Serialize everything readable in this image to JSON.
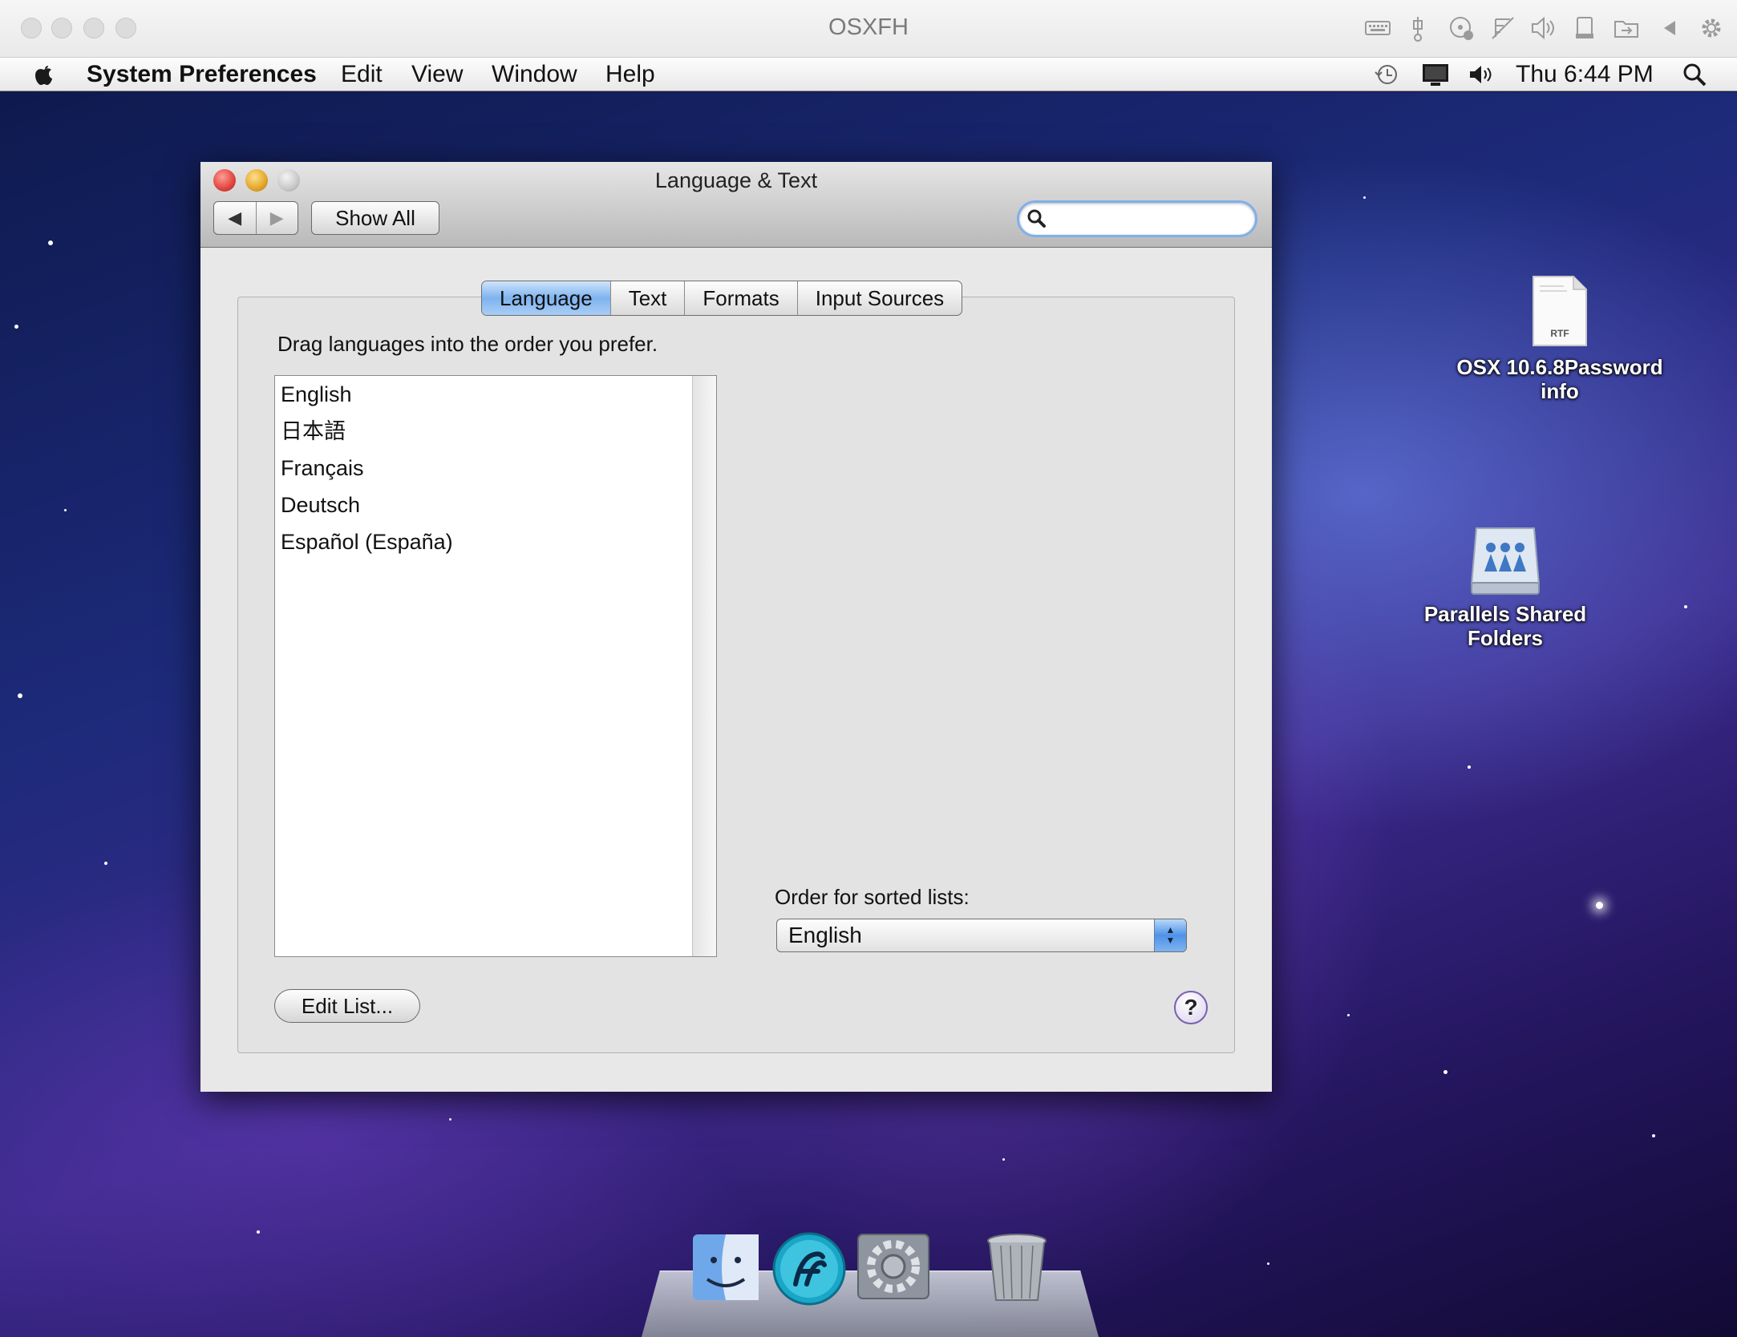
{
  "host": {
    "title": "OSXFH"
  },
  "menubar": {
    "app_name": "System Preferences",
    "items": [
      "Edit",
      "View",
      "Window",
      "Help"
    ],
    "clock": "Thu 6:44 PM"
  },
  "window": {
    "title": "Language & Text",
    "show_all_label": "Show All",
    "search_placeholder": "",
    "tabs": [
      "Language",
      "Text",
      "Formats",
      "Input Sources"
    ],
    "active_tab": "Language",
    "instruction": "Drag languages into the order you prefer.",
    "languages": [
      "English",
      "日本語",
      "Français",
      "Deutsch",
      "Español (España)"
    ],
    "sort_label": "Order for sorted lists:",
    "sort_value": "English",
    "edit_list_label": "Edit List...",
    "help_label": "?"
  },
  "desktop": {
    "icons": [
      {
        "label": "OSX 10.6.8Password info",
        "badge": "RTF",
        "icon": "rtf-document-icon"
      },
      {
        "label": "Parallels Shared Folders",
        "icon": "shared-folders-drive-icon"
      }
    ]
  },
  "dock": {
    "items": [
      {
        "icon": "finder-icon"
      },
      {
        "icon": "app-blue-swirl-icon"
      },
      {
        "icon": "system-preferences-icon"
      },
      {
        "icon": "trash-icon"
      }
    ]
  },
  "colors": {
    "accent_blue": "#7eb3ef",
    "close_red": "#e0443e",
    "minimize_yellow": "#e2a528"
  }
}
